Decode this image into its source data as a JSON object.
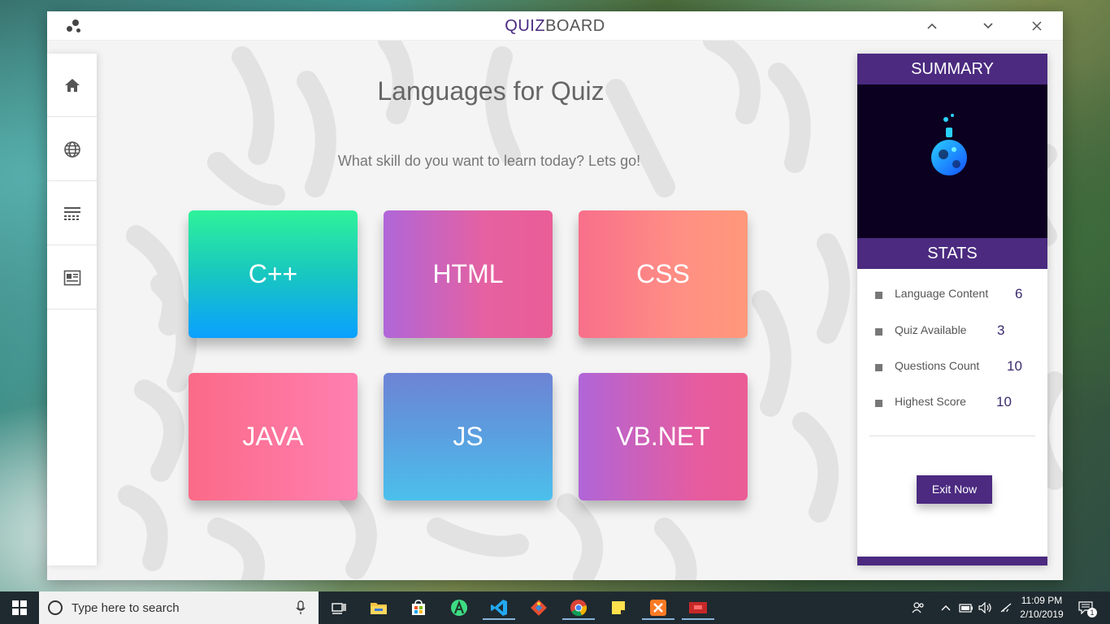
{
  "window": {
    "title_accent": "QUIZ",
    "title_rest": "BOARD"
  },
  "main": {
    "heading": "Languages for Quiz",
    "subheading": "What skill do you want to learn today? Lets go!",
    "cards": [
      {
        "label": "C++"
      },
      {
        "label": "HTML"
      },
      {
        "label": "CSS"
      },
      {
        "label": "JAVA"
      },
      {
        "label": "JS"
      },
      {
        "label": "VB.NET"
      }
    ]
  },
  "sidebar": {
    "items": [
      {
        "icon": "home-icon"
      },
      {
        "icon": "globe-icon"
      },
      {
        "icon": "list-icon"
      },
      {
        "icon": "article-icon"
      }
    ]
  },
  "summary": {
    "title": "SUMMARY",
    "stats_title": "STATS",
    "stats": [
      {
        "label": "Language Content",
        "value": "6"
      },
      {
        "label": "Quiz Available",
        "value": "3"
      },
      {
        "label": "Questions Count",
        "value": "10"
      },
      {
        "label": "Highest Score",
        "value": "10"
      }
    ],
    "exit_label": "Exit Now"
  },
  "taskbar": {
    "search_placeholder": "Type here to search",
    "time": "11:09 PM",
    "date": "2/10/2019",
    "notification_count": "1"
  },
  "colors": {
    "accent": "#4b2a80",
    "summary_art_bg": "#0c0020"
  }
}
